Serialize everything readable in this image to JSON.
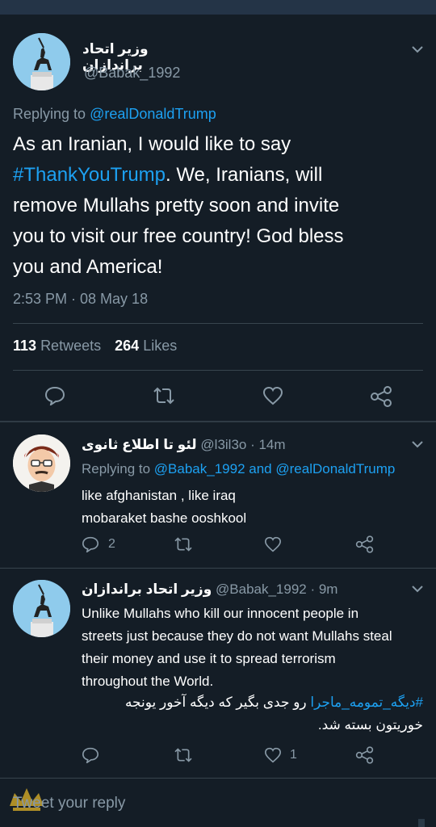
{
  "main_tweet": {
    "display_name": "وزیر اتحاد براندازان",
    "handle": "@Babak_1992",
    "replying_prefix": "Replying to",
    "replying_to": "@realDonaldTrump",
    "text_lines": [
      {
        "pre": "As an Iranian, I would like to say",
        "tag": "",
        "post": ""
      },
      {
        "pre": "",
        "tag": "#ThankYouTrump",
        "post": ". We, Iranians, will"
      },
      {
        "pre": "remove Mullahs pretty soon and invite",
        "tag": "",
        "post": ""
      },
      {
        "pre": "you to visit our free country! God bless",
        "tag": "",
        "post": ""
      },
      {
        "pre": "you and America!",
        "tag": "",
        "post": ""
      }
    ],
    "timestamp": "2:53 PM · 08 May 18",
    "retweets_count": "113",
    "retweets_label": "Retweets",
    "likes_count": "264",
    "likes_label": "Likes"
  },
  "reply1": {
    "display_name": "لئو تا اطلاع ثانوی",
    "handle_time": "@l3il3o · 14m",
    "replying_prefix": "Replying to",
    "replying_to_1": "@Babak_1992",
    "replying_and": "and",
    "replying_to_2": "@realDonaldTrump",
    "text_lines": [
      "like afghanistan , like iraq",
      "mobaraket bashe ooshkool"
    ],
    "reply_count": "2"
  },
  "reply2": {
    "display_name": "وزیر اتحاد براندازان",
    "handle_time": "@Babak_1992 · 9m",
    "text_lines": [
      "Unlike Mullahs who kill our innocent people in",
      "streets just because they do not want Mullahs steal",
      "their money and use it to spread terrorism",
      "throughout the World."
    ],
    "persian_hashtag": "#دیگه_تمومه_ماجرا",
    "persian_line1_rest": " رو جدی بگیر که دیگه آخور یونجه",
    "persian_line2": "خوریتون بسته شد.",
    "like_count": "1"
  },
  "compose": {
    "placeholder": "Tweet your reply"
  },
  "colors": {
    "background": "#141d26",
    "accent": "#1da1f2",
    "muted": "#8899a6",
    "divider": "#38444d"
  }
}
